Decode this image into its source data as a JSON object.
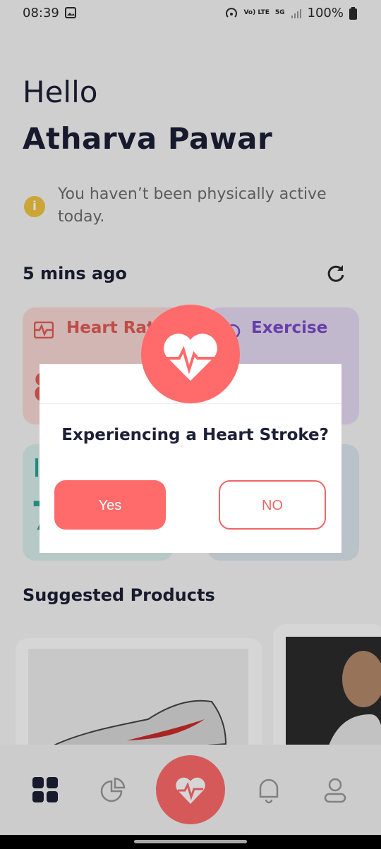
{
  "status_bar": {
    "time": "08:39",
    "battery": "100%",
    "network": "5G",
    "volte": "Vo) LTE"
  },
  "greeting": {
    "hello": "Hello",
    "name": "Atharva Pawar"
  },
  "alert": {
    "icon": "info-icon",
    "text": "You haven’t been physically active today."
  },
  "updated": {
    "label": "5 mins ago"
  },
  "cards": {
    "heart_rate": {
      "title": "Heart Rat",
      "value": "8",
      "color": "#e35b56"
    },
    "exercise": {
      "title": "Exercise",
      "color": "#7a4bc9"
    },
    "third": {
      "value": "7",
      "color": "#2aa596"
    }
  },
  "suggested": {
    "title": "Suggested Products"
  },
  "dialog": {
    "question": "Experiencing a Heart Stroke?",
    "yes_label": "Yes",
    "no_label": "NO",
    "accent": "#ff6b6b"
  },
  "bottom_nav": {
    "items": [
      "dashboard-icon",
      "chart-pie-icon",
      "heart-pulse-icon",
      "bell-icon",
      "profile-icon"
    ]
  }
}
